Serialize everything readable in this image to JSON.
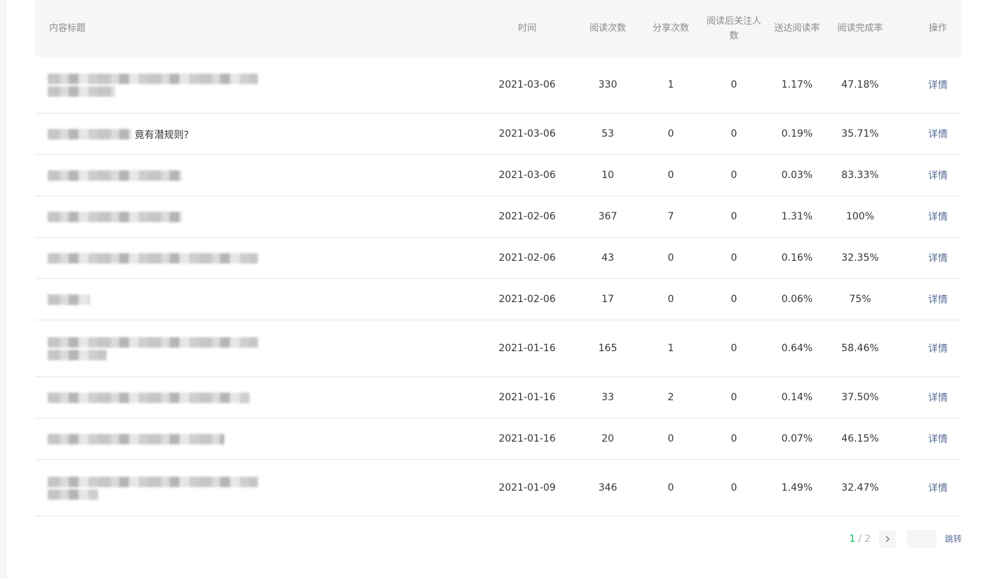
{
  "columns": {
    "title": "内容标题",
    "time": "时间",
    "reads": "阅读次数",
    "shares": "分享次数",
    "follows": "阅读后关注人数",
    "delivery_rate": "送达阅读率",
    "completion_rate": "阅读完成率",
    "action": "操作"
  },
  "rows": [
    {
      "title_partial": "",
      "time": "2021-03-06",
      "reads": "330",
      "shares": "1",
      "follows": "0",
      "delivery_rate": "1.17%",
      "completion_rate": "47.18%",
      "action": "详情"
    },
    {
      "title_partial": "竟有潜规则?",
      "time": "2021-03-06",
      "reads": "53",
      "shares": "0",
      "follows": "0",
      "delivery_rate": "0.19%",
      "completion_rate": "35.71%",
      "action": "详情"
    },
    {
      "title_partial": "",
      "time": "2021-03-06",
      "reads": "10",
      "shares": "0",
      "follows": "0",
      "delivery_rate": "0.03%",
      "completion_rate": "83.33%",
      "action": "详情"
    },
    {
      "title_partial": "",
      "time": "2021-02-06",
      "reads": "367",
      "shares": "7",
      "follows": "0",
      "delivery_rate": "1.31%",
      "completion_rate": "100%",
      "action": "详情"
    },
    {
      "title_partial": "",
      "time": "2021-02-06",
      "reads": "43",
      "shares": "0",
      "follows": "0",
      "delivery_rate": "0.16%",
      "completion_rate": "32.35%",
      "action": "详情"
    },
    {
      "title_partial": "",
      "time": "2021-02-06",
      "reads": "17",
      "shares": "0",
      "follows": "0",
      "delivery_rate": "0.06%",
      "completion_rate": "75%",
      "action": "详情"
    },
    {
      "title_partial": "",
      "time": "2021-01-16",
      "reads": "165",
      "shares": "1",
      "follows": "0",
      "delivery_rate": "0.64%",
      "completion_rate": "58.46%",
      "action": "详情"
    },
    {
      "title_partial": "",
      "time": "2021-01-16",
      "reads": "33",
      "shares": "2",
      "follows": "0",
      "delivery_rate": "0.14%",
      "completion_rate": "37.50%",
      "action": "详情"
    },
    {
      "title_partial": "",
      "time": "2021-01-16",
      "reads": "20",
      "shares": "0",
      "follows": "0",
      "delivery_rate": "0.07%",
      "completion_rate": "46.15%",
      "action": "详情"
    },
    {
      "title_partial": "",
      "time": "2021-01-09",
      "reads": "346",
      "shares": "0",
      "follows": "0",
      "delivery_rate": "1.49%",
      "completion_rate": "32.47%",
      "action": "详情"
    }
  ],
  "pagination": {
    "current": "1",
    "separator": "/",
    "total": "2",
    "jump_label": "跳转",
    "input_value": ""
  }
}
